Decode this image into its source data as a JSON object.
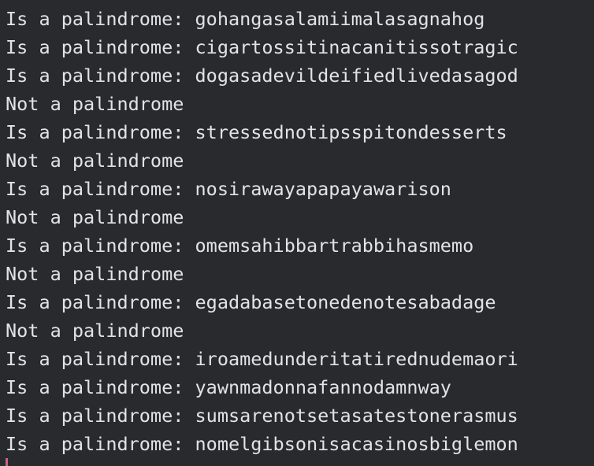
{
  "terminal": {
    "lines": [
      "Is a palindrome: gohangasalamiimalasagnahog",
      "Is a palindrome: cigartossitinacanitissotragic",
      "Is a palindrome: dogasadevildeifiedlivedasagod",
      "Not a palindrome",
      "Is a palindrome: stressednotipsspitondesserts",
      "Not a palindrome",
      "Is a palindrome: nosirawayapapayawarison",
      "Not a palindrome",
      "Is a palindrome: omemsahibbartrabbihasmemo",
      "Not a palindrome",
      "Is a palindrome: egadabasetonedenotesabadage",
      "Not a palindrome",
      "Is a palindrome: iroamedunderitatirednudemaori",
      "Is a palindrome: yawnmadonnafannodamnway",
      "Is a palindrome: sumsarenotsetasatestonerasmus",
      "Is a palindrome: nomelgibsonisacasinosbiglemon"
    ]
  },
  "colors": {
    "background": "#282a2e",
    "text": "#e1e3e6",
    "cursor": "#e0597e"
  }
}
